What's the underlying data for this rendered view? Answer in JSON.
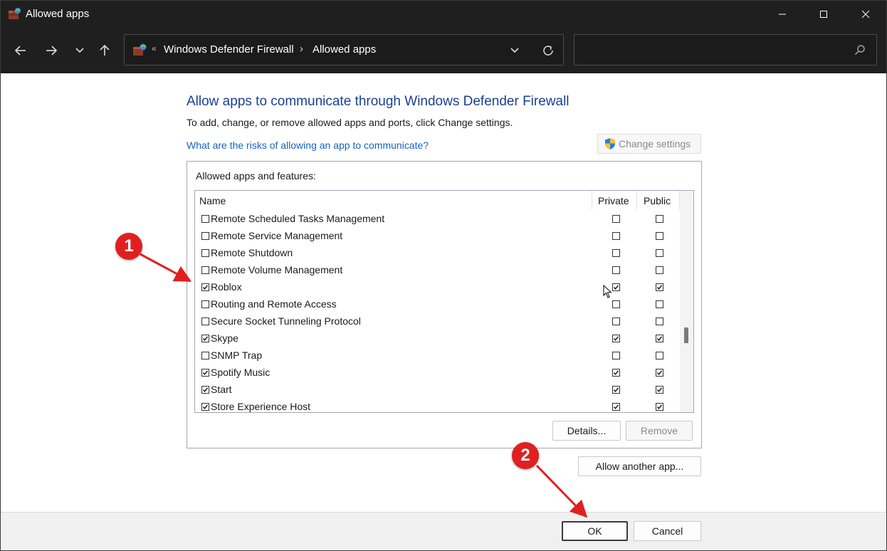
{
  "window": {
    "title": "Allowed apps"
  },
  "address_bar": {
    "overflow": "«",
    "crumbs": [
      "Windows Defender Firewall",
      "Allowed apps"
    ],
    "separator": "›"
  },
  "search": {
    "placeholder": ""
  },
  "content": {
    "heading": "Allow apps to communicate through Windows Defender Firewall",
    "subtext": "To add, change, or remove allowed apps and ports, click Change settings.",
    "risk_link": "What are the risks of allowing an app to communicate?",
    "change_settings": "Change settings",
    "group_title": "Allowed apps and features:"
  },
  "list": {
    "columns": {
      "name": "Name",
      "private": "Private",
      "public": "Public"
    },
    "rows": [
      {
        "name": "Remote Scheduled Tasks Management",
        "enabled": false,
        "private": false,
        "public": false
      },
      {
        "name": "Remote Service Management",
        "enabled": false,
        "private": false,
        "public": false
      },
      {
        "name": "Remote Shutdown",
        "enabled": false,
        "private": false,
        "public": false
      },
      {
        "name": "Remote Volume Management",
        "enabled": false,
        "private": false,
        "public": false
      },
      {
        "name": "Roblox",
        "enabled": true,
        "private": true,
        "public": true
      },
      {
        "name": "Routing and Remote Access",
        "enabled": false,
        "private": false,
        "public": false
      },
      {
        "name": "Secure Socket Tunneling Protocol",
        "enabled": false,
        "private": false,
        "public": false
      },
      {
        "name": "Skype",
        "enabled": true,
        "private": true,
        "public": true
      },
      {
        "name": "SNMP Trap",
        "enabled": false,
        "private": false,
        "public": false
      },
      {
        "name": "Spotify Music",
        "enabled": true,
        "private": true,
        "public": true
      },
      {
        "name": "Start",
        "enabled": true,
        "private": true,
        "public": true
      },
      {
        "name": "Store Experience Host",
        "enabled": true,
        "private": true,
        "public": true
      }
    ]
  },
  "buttons": {
    "details": "Details...",
    "remove": "Remove",
    "allow_another": "Allow another app...",
    "ok": "OK",
    "cancel": "Cancel"
  },
  "annotations": {
    "step1": "1",
    "step2": "2"
  },
  "colors": {
    "heading": "#1a3f95",
    "link": "#1563c4",
    "badge": "#e02020",
    "titlebar": "#1f1f1f"
  }
}
